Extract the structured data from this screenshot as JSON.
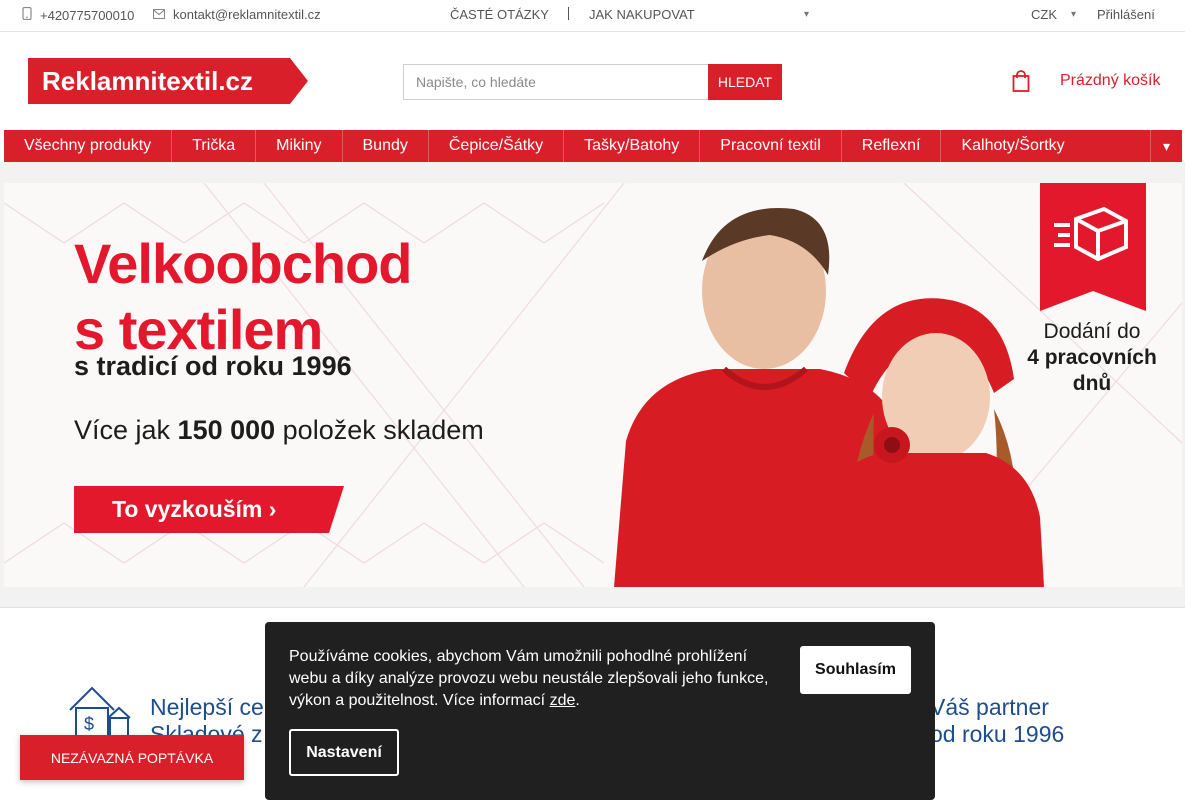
{
  "topbar": {
    "phone": "+420775700010",
    "email": "kontakt@reklamnitextil.cz",
    "faq": "ČASTÉ OTÁZKY",
    "how_to_buy": "JAK NAKUPOVAT",
    "currency": "CZK",
    "login": "Přihlášení",
    "icons": [
      "phone-icon",
      "mail-icon",
      "chevron-down-icon",
      "chevron-down-icon"
    ]
  },
  "header": {
    "logo_text": "Reklamnitextil.cz",
    "search_placeholder": "Napište, co hledáte",
    "search_button": "HLEDAT",
    "cart_label": "Prázdný košík"
  },
  "nav": {
    "items": [
      "Všechny produkty",
      "Trička",
      "Mikiny",
      "Bundy",
      "Čepice/Šátky",
      "Tašky/Batohy",
      "Pracovní textil",
      "Reflexní",
      "Kalhoty/Šortky"
    ]
  },
  "banner": {
    "headline_1": "Velkoobchod",
    "headline_2": "s textilem",
    "tagline": "s tradicí od roku 1996",
    "stock_prefix": "Více jak ",
    "stock_number": "150 000",
    "stock_suffix": " položek skladem",
    "cta": "To vyzkouším ›",
    "delivery_1": "Dodání do",
    "delivery_2": "4 pracovních",
    "delivery_3": "dnů"
  },
  "features": {
    "left_1": "Nejlepší ce",
    "left_2": "Skladové z",
    "right_1": "Váš partner",
    "right_2": "od roku 1996"
  },
  "cookie": {
    "message": "Používáme cookies, abychom Vám umožnili pohodlné prohlížení webu a díky analýze provozu webu neustále zlepšovali jeho funkce, výkon a použitelnost. Více informací ",
    "link": "zde",
    "message_end": ".",
    "agree": "Souhlasím",
    "settings": "Nastavení"
  },
  "inquiry_button": "NEZÁVAZNÁ POPTÁVKA",
  "colors": {
    "brand_red": "#d9202a",
    "banner_red": "#e3182d",
    "feature_blue": "#1f4d8a",
    "cookie_bg": "#202020"
  }
}
